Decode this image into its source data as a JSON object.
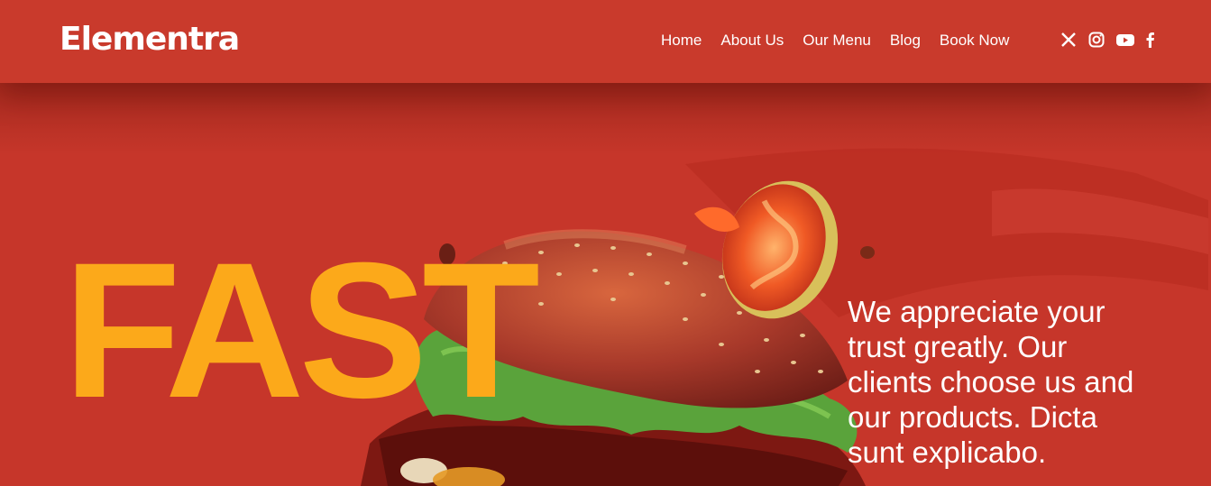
{
  "header": {
    "logo_text": "Elementra",
    "nav": [
      {
        "label": "Home"
      },
      {
        "label": "About Us"
      },
      {
        "label": "Our Menu"
      },
      {
        "label": "Blog"
      },
      {
        "label": "Book Now"
      }
    ],
    "social_icons": [
      "x-icon",
      "instagram-icon",
      "youtube-icon",
      "facebook-icon"
    ]
  },
  "hero": {
    "headline": "FAST",
    "tagline": "We appreciate your trust greatly. Our clients choose us and our products. Dicta sunt explicabo.",
    "image": "burger-image"
  },
  "colors": {
    "background": "#c6362a",
    "header": "#c93a2c",
    "headline": "#fca91a",
    "text": "#ffffff"
  }
}
